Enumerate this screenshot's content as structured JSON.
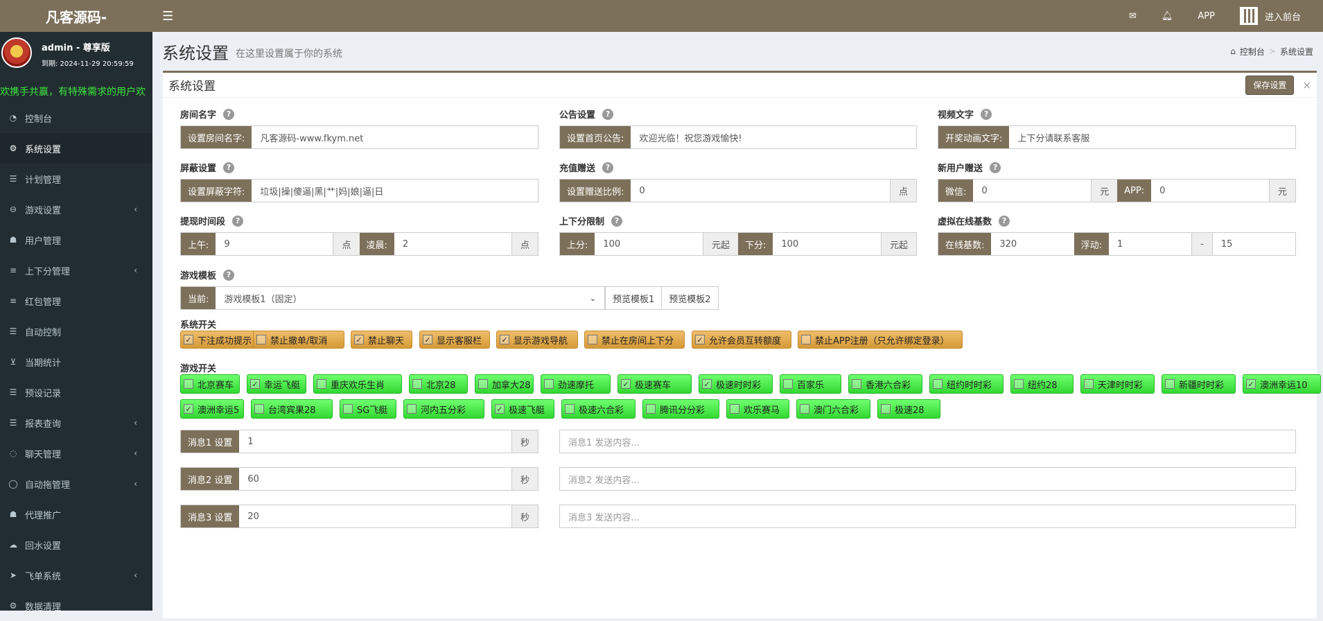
{
  "app": {
    "logo": "凡客源码-",
    "app_label": "APP",
    "front_label": "进入前台"
  },
  "user": {
    "name": "admin - 尊享版",
    "expiry": "到期: 2024-11-29 20:59:59",
    "marquee": "欢携手共赢，有特殊需求的用户欢"
  },
  "menu": [
    {
      "label": "控制台",
      "icon": "dashboard-icon"
    },
    {
      "label": "系统设置",
      "icon": "cogs-icon",
      "active": true
    },
    {
      "label": "计划管理",
      "icon": "list-icon"
    },
    {
      "label": "游戏设置",
      "icon": "gamepad-icon",
      "chevron": true
    },
    {
      "label": "用户管理",
      "icon": "users-icon"
    },
    {
      "label": "上下分管理",
      "icon": "database-icon",
      "chevron": true
    },
    {
      "label": "红包管理",
      "icon": "database-icon"
    },
    {
      "label": "自动控制",
      "icon": "list-icon"
    },
    {
      "label": "当期统计",
      "icon": "cart-icon"
    },
    {
      "label": "预设记录",
      "icon": "list-icon"
    },
    {
      "label": "报表查询",
      "icon": "list-icon",
      "chevron": true
    },
    {
      "label": "聊天管理",
      "icon": "chat-icon",
      "chevron": true
    },
    {
      "label": "自动拖管理",
      "icon": "comment-icon",
      "chevron": true
    },
    {
      "label": "代理推广",
      "icon": "user-plus-icon"
    },
    {
      "label": "回水设置",
      "icon": "cloud-icon"
    },
    {
      "label": "飞单系统",
      "icon": "send-icon",
      "chevron": true
    },
    {
      "label": "数据清理",
      "icon": "gear-icon"
    }
  ],
  "page": {
    "title": "系统设置",
    "subtitle": "在这里设置属于你的系统",
    "crumb_home": "控制台",
    "crumb_current": "系统设置"
  },
  "box": {
    "title": "系统设置",
    "save_label": "保存设置",
    "close": "×"
  },
  "fields": {
    "room": {
      "label": "房间名字",
      "addon": "设置房间名字:",
      "value": "凡客源码-www.fkym.net"
    },
    "notice": {
      "label": "公告设置",
      "addon": "设置首页公告:",
      "value": "欢迎光临！祝您游戏愉快!"
    },
    "video": {
      "label": "视频文字",
      "addon": "开奖动画文字:",
      "value": "上下分请联系客服"
    },
    "shield": {
      "label": "屏蔽设置",
      "addon": "设置屏蔽字符:",
      "value": "垃圾|操|傻逼|黑|艹|妈|娘|逼|日"
    },
    "recharge": {
      "label": "充值赠送",
      "addon": "设置赠送比例:",
      "value": "0",
      "suffix": "点"
    },
    "newuser": {
      "label": "新用户赠送",
      "wx_addon": "微信:",
      "wx_value": "0",
      "wx_suffix": "元",
      "app_addon": "APP:",
      "app_value": "0",
      "app_suffix": "元"
    },
    "withdraw": {
      "label": "提现时间段",
      "am_addon": "上午:",
      "am_value": "9",
      "am_suffix": "点",
      "night_addon": "凌晨:",
      "night_value": "2",
      "night_suffix": "点"
    },
    "limit": {
      "label": "上下分限制",
      "up_addon": "上分:",
      "up_value": "100",
      "up_suffix": "元起",
      "down_addon": "下分:",
      "down_value": "100",
      "down_suffix": "元起"
    },
    "online": {
      "label": "虚拟在线基数",
      "base_addon": "在线基数:",
      "base_value": "320",
      "float_addon": "浮动:",
      "float_min": "1",
      "float_sep": "-",
      "float_max": "15"
    },
    "template": {
      "label": "游戏模板",
      "addon": "当前:",
      "selected": "游戏模板1（固定）",
      "preview1": "预览模板1",
      "preview2": "预览模板2"
    }
  },
  "system_switches": {
    "title": "系统开关",
    "items": [
      {
        "label": "下注成功提示",
        "checked": true
      },
      {
        "label": "禁止撤单/取消",
        "checked": false
      },
      {
        "label": "禁止聊天",
        "checked": true
      },
      {
        "label": "显示客服栏",
        "checked": true
      },
      {
        "label": "显示游戏导航",
        "checked": true
      },
      {
        "label": "禁止在房间上下分",
        "checked": false
      },
      {
        "label": "允许会员互转额度",
        "checked": true
      },
      {
        "label": "禁止APP注册（只允许绑定登录）",
        "checked": false
      }
    ]
  },
  "game_switches": {
    "title": "游戏开关",
    "items": [
      {
        "label": "北京赛车",
        "checked": false
      },
      {
        "label": "幸运飞艇",
        "checked": true
      },
      {
        "label": "重庆欢乐生肖",
        "checked": false
      },
      {
        "label": "北京28",
        "checked": false
      },
      {
        "label": "加拿大28",
        "checked": false
      },
      {
        "label": "劲速摩托",
        "checked": false
      },
      {
        "label": "极速赛车",
        "checked": true
      },
      {
        "label": "极速时时彩",
        "checked": true
      },
      {
        "label": "百家乐",
        "checked": false
      },
      {
        "label": "香港六合彩",
        "checked": false
      },
      {
        "label": "纽约时时彩",
        "checked": false
      },
      {
        "label": "纽约28",
        "checked": false
      },
      {
        "label": "天津时时彩",
        "checked": false
      },
      {
        "label": "新疆时时彩",
        "checked": false
      },
      {
        "label": "澳洲幸运10",
        "checked": true
      },
      {
        "label": "澳洲幸运5",
        "checked": true
      },
      {
        "label": "台湾宾果28",
        "checked": false
      },
      {
        "label": "SG飞艇",
        "checked": false
      },
      {
        "label": "河内五分彩",
        "checked": false
      },
      {
        "label": "极速飞艇",
        "checked": true
      },
      {
        "label": "极速六合彩",
        "checked": false
      },
      {
        "label": "腾讯分分彩",
        "checked": false
      },
      {
        "label": "欢乐赛马",
        "checked": false
      },
      {
        "label": "澳门六合彩",
        "checked": false
      },
      {
        "label": "极速28",
        "checked": false
      }
    ]
  },
  "messages": [
    {
      "addon": "消息1 设置",
      "value": "1",
      "suffix": "秒",
      "placeholder": "消息1 发送内容..."
    },
    {
      "addon": "消息2 设置",
      "value": "60",
      "suffix": "秒",
      "placeholder": "消息2 发送内容..."
    },
    {
      "addon": "消息3 设置",
      "value": "20",
      "suffix": "秒",
      "placeholder": "消息3 发送内容..."
    }
  ],
  "colors": {
    "brand": "#7d705a",
    "sidebar": "#222d32",
    "switch_orange": "#e4a94f",
    "switch_green": "#4ff04f"
  }
}
